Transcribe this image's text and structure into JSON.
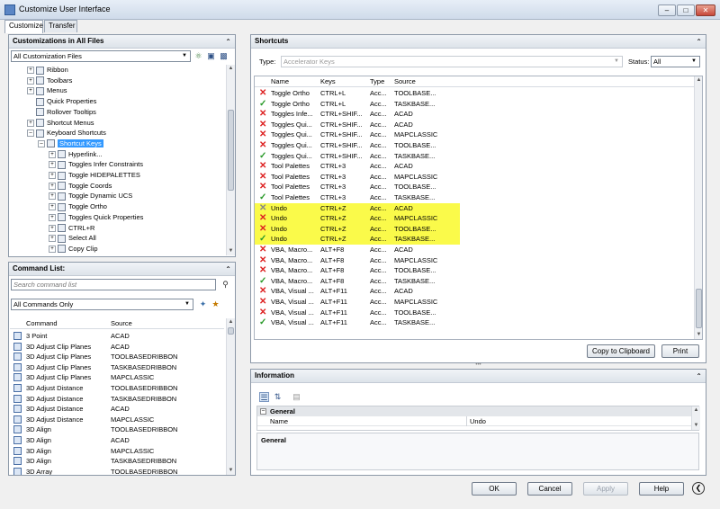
{
  "window": {
    "title": "Customize User Interface",
    "min": "–",
    "max": "□",
    "close": "✕"
  },
  "tabs": [
    "Customize",
    "Transfer"
  ],
  "customizations_panel": {
    "title": "Customizations in All Files",
    "file_combo": "All Customization Files",
    "tree": [
      {
        "label": "Ribbon",
        "exp": "+",
        "depth": 0
      },
      {
        "label": "Toolbars",
        "exp": "+",
        "depth": 0
      },
      {
        "label": "Menus",
        "exp": "+",
        "depth": 0
      },
      {
        "label": "Quick Properties",
        "exp": "",
        "depth": 0
      },
      {
        "label": "Rollover Tooltips",
        "exp": "",
        "depth": 0
      },
      {
        "label": "Shortcut Menus",
        "exp": "+",
        "depth": 0
      },
      {
        "label": "Keyboard Shortcuts",
        "exp": "–",
        "depth": 0
      },
      {
        "label": "Shortcut Keys",
        "exp": "–",
        "depth": 1,
        "selected": true
      },
      {
        "label": "Hyperlink...",
        "exp": "+",
        "depth": 2
      },
      {
        "label": "Toggles Infer Constraints",
        "exp": "+",
        "depth": 2
      },
      {
        "label": "Toggle HIDEPALETTES",
        "exp": "+",
        "depth": 2
      },
      {
        "label": "Toggle Coords",
        "exp": "+",
        "depth": 2
      },
      {
        "label": "Toggle Dynamic UCS",
        "exp": "+",
        "depth": 2
      },
      {
        "label": "Toggle Ortho",
        "exp": "+",
        "depth": 2
      },
      {
        "label": "Toggles Quick Properties",
        "exp": "+",
        "depth": 2
      },
      {
        "label": "CTRL+R",
        "exp": "+",
        "depth": 2
      },
      {
        "label": "Select All",
        "exp": "+",
        "depth": 2
      },
      {
        "label": "Copy Clip",
        "exp": "+",
        "depth": 2
      }
    ]
  },
  "command_list": {
    "title": "Command List:",
    "search_placeholder": "Search command list",
    "filter": "All Commands Only",
    "columns": [
      "Command",
      "Source"
    ],
    "rows": [
      [
        "3 Point",
        "ACAD"
      ],
      [
        "3D Adjust Clip Planes",
        "ACAD"
      ],
      [
        "3D Adjust Clip Planes",
        "TOOLBASEDRIBBON"
      ],
      [
        "3D Adjust Clip Planes",
        "TASKBASEDRIBBON"
      ],
      [
        "3D Adjust Clip Planes",
        "MAPCLASSIC"
      ],
      [
        "3D Adjust Distance",
        "TOOLBASEDRIBBON"
      ],
      [
        "3D Adjust Distance",
        "TASKBASEDRIBBON"
      ],
      [
        "3D Adjust Distance",
        "ACAD"
      ],
      [
        "3D Adjust Distance",
        "MAPCLASSIC"
      ],
      [
        "3D Align",
        "TOOLBASEDRIBBON"
      ],
      [
        "3D Align",
        "ACAD"
      ],
      [
        "3D Align",
        "MAPCLASSIC"
      ],
      [
        "3D Align",
        "TASKBASEDRIBBON"
      ],
      [
        "3D Array",
        "TOOLBASEDRIBBON"
      ]
    ]
  },
  "shortcuts": {
    "title": "Shortcuts",
    "type_label": "Type:",
    "type_value": "Accelerator Keys",
    "status_label": "Status:",
    "status_value": "All",
    "columns": [
      "Name",
      "Keys",
      "Type",
      "Source"
    ],
    "rows": [
      {
        "m": "x",
        "name": "Toggle Ortho",
        "keys": "CTRL+L",
        "type": "Acc...",
        "source": "TOOLBASE..."
      },
      {
        "m": "v",
        "name": "Toggle Ortho",
        "keys": "CTRL+L",
        "type": "Acc...",
        "source": "TASKBASE..."
      },
      {
        "m": "x",
        "name": "Toggles Infe...",
        "keys": "CTRL+SHIF...",
        "type": "Acc...",
        "source": "ACAD"
      },
      {
        "m": "x",
        "name": "Toggles Qui...",
        "keys": "CTRL+SHIF...",
        "type": "Acc...",
        "source": "ACAD"
      },
      {
        "m": "x",
        "name": "Toggles Qui...",
        "keys": "CTRL+SHIF...",
        "type": "Acc...",
        "source": "MAPCLASSIC"
      },
      {
        "m": "x",
        "name": "Toggles Qui...",
        "keys": "CTRL+SHIF...",
        "type": "Acc...",
        "source": "TOOLBASE..."
      },
      {
        "m": "v",
        "name": "Toggles Qui...",
        "keys": "CTRL+SHIF...",
        "type": "Acc...",
        "source": "TASKBASE..."
      },
      {
        "m": "x",
        "name": "Tool Palettes",
        "keys": "CTRL+3",
        "type": "Acc...",
        "source": "ACAD"
      },
      {
        "m": "x",
        "name": "Tool Palettes",
        "keys": "CTRL+3",
        "type": "Acc...",
        "source": "MAPCLASSIC"
      },
      {
        "m": "x",
        "name": "Tool Palettes",
        "keys": "CTRL+3",
        "type": "Acc...",
        "source": "TOOLBASE..."
      },
      {
        "m": "v",
        "name": "Tool Palettes",
        "keys": "CTRL+3",
        "type": "Acc...",
        "source": "TASKBASE..."
      },
      {
        "m": "g",
        "name": "Undo",
        "keys": "CTRL+Z",
        "type": "Acc...",
        "source": "ACAD",
        "hl": true
      },
      {
        "m": "x",
        "name": "Undo",
        "keys": "CTRL+Z",
        "type": "Acc...",
        "source": "MAPCLASSIC",
        "hl": true
      },
      {
        "m": "x",
        "name": "Undo",
        "keys": "CTRL+Z",
        "type": "Acc...",
        "source": "TOOLBASE...",
        "hl": true
      },
      {
        "m": "v",
        "name": "Undo",
        "keys": "CTRL+Z",
        "type": "Acc...",
        "source": "TASKBASE...",
        "hl": true
      },
      {
        "m": "x",
        "name": "VBA, Macro...",
        "keys": "ALT+F8",
        "type": "Acc...",
        "source": "ACAD"
      },
      {
        "m": "x",
        "name": "VBA, Macro...",
        "keys": "ALT+F8",
        "type": "Acc...",
        "source": "MAPCLASSIC"
      },
      {
        "m": "x",
        "name": "VBA, Macro...",
        "keys": "ALT+F8",
        "type": "Acc...",
        "source": "TOOLBASE..."
      },
      {
        "m": "v",
        "name": "VBA, Macro...",
        "keys": "ALT+F8",
        "type": "Acc...",
        "source": "TASKBASE..."
      },
      {
        "m": "x",
        "name": "VBA, Visual ...",
        "keys": "ALT+F11",
        "type": "Acc...",
        "source": "ACAD"
      },
      {
        "m": "x",
        "name": "VBA, Visual ...",
        "keys": "ALT+F11",
        "type": "Acc...",
        "source": "MAPCLASSIC"
      },
      {
        "m": "x",
        "name": "VBA, Visual ...",
        "keys": "ALT+F11",
        "type": "Acc...",
        "source": "TOOLBASE..."
      },
      {
        "m": "v",
        "name": "VBA, Visual ...",
        "keys": "ALT+F11",
        "type": "Acc...",
        "source": "TASKBASE..."
      }
    ],
    "copy_button": "Copy to Clipboard",
    "print_button": "Print"
  },
  "information": {
    "title": "Information",
    "section": "General",
    "prop_name": "Name",
    "prop_value": "Undo",
    "description_title": "General"
  },
  "footer": {
    "ok": "OK",
    "cancel": "Cancel",
    "apply": "Apply",
    "help": "Help"
  },
  "colors": {
    "highlight": "#fafa4a",
    "selection": "#3399ff",
    "error_mark": "#d22",
    "ok_mark": "#2a9a2a"
  }
}
